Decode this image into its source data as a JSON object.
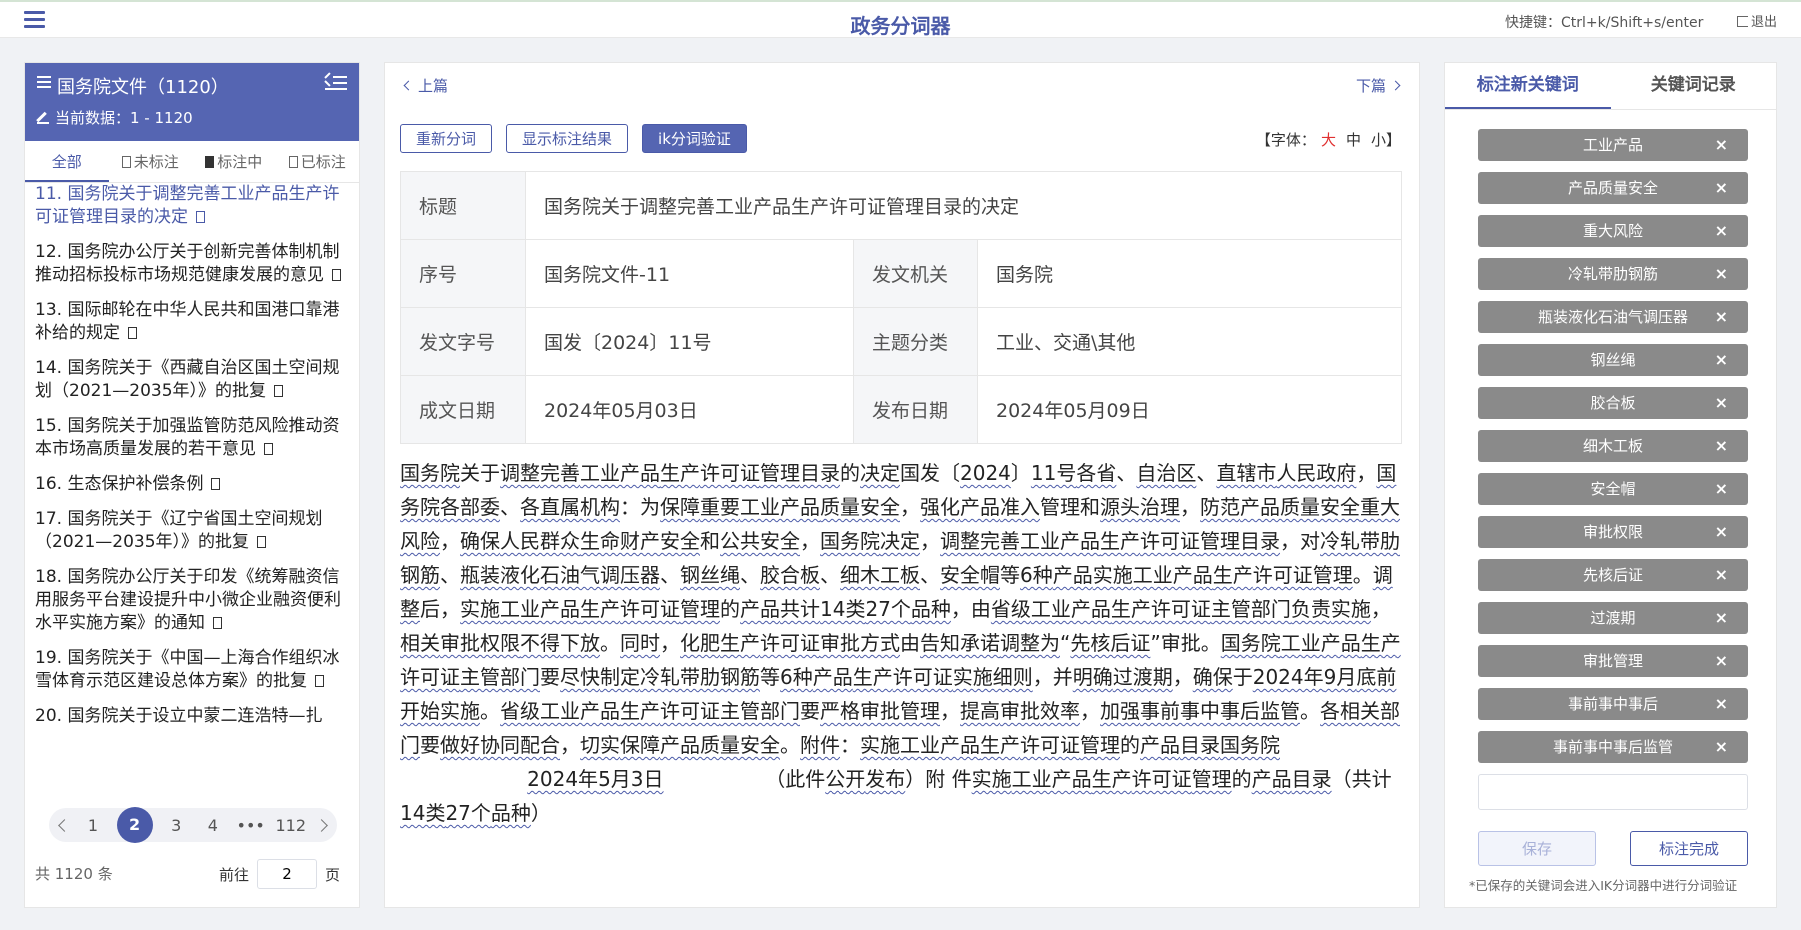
{
  "app": {
    "title": "政务分词器",
    "shortcut": "快捷键：Ctrl+k/Shift+s/enter",
    "logout": "退出"
  },
  "sidebar": {
    "title": "国务院文件（1120）",
    "current_data": "当前数据：1 - 1120",
    "tabs": [
      "全部",
      "未标注",
      "标注中",
      "已标注"
    ],
    "items": [
      "11. 国务院关于调整完善工业产品生产许可证管理目录的决定",
      "12. 国务院办公厅关于创新完善体制机制推动招标投标市场规范健康发展的意见",
      "13. 国际邮轮在中华人民共和国港口靠港补给的规定",
      "14. 国务院关于《西藏自治区国土空间规划（2021—2035年）》的批复",
      "15. 国务院关于加强监管防范风险推动资本市场高质量发展的若干意见",
      "16. 生态保护补偿条例",
      "17. 国务院关于《辽宁省国土空间规划（2021—2035年）》的批复",
      "18. 国务院办公厅关于印发《统筹融资信用服务平台建设提升中小微企业融资便利水平实施方案》的通知",
      "19. 国务院关于《中国—上海合作组织冰雪体育示范区建设总体方案》的批复",
      "20. 国务院关于设立中蒙二连浩特—扎"
    ],
    "pager": {
      "pages": [
        "1",
        "2",
        "3",
        "4",
        "•••",
        "112"
      ],
      "current": "2",
      "total": "共 1120 条",
      "goto_label": "前往",
      "goto_value": "2",
      "goto_suffix": "页"
    }
  },
  "main": {
    "prev": "上篇",
    "next": "下篇",
    "buttons": {
      "resegment": "重新分词",
      "show_result": "显示标注结果",
      "ik_verify": "ik分词验证"
    },
    "font": {
      "label": "【字体：",
      "large": "大",
      "medium": "中",
      "small": "小",
      "close": "】"
    },
    "meta": {
      "title_label": "标题",
      "title_value": "国务院关于调整完善工业产品生产许可证管理目录的决定",
      "serial_label": "序号",
      "serial_value": "国务院文件-11",
      "issuer_label": "发文机关",
      "issuer_value": "国务院",
      "docno_label": "发文字号",
      "docno_value": "国发〔2024〕11号",
      "topic_label": "主题分类",
      "topic_value": "工业、交通\\其他",
      "written_label": "成文日期",
      "written_value": "2024年05月03日",
      "publish_label": "发布日期",
      "publish_value": "2024年05月09日"
    },
    "body_segments": [
      {
        "t": "国务院",
        "k": 1
      },
      {
        "t": "关于",
        "k": 0
      },
      {
        "t": "调整",
        "k": 1
      },
      {
        "t": "完善",
        "k": 1
      },
      {
        "t": "工业产品",
        "k": 1
      },
      {
        "t": "生产",
        "k": 1
      },
      {
        "t": "许可证",
        "k": 1
      },
      {
        "t": "管理",
        "k": 1
      },
      {
        "t": "目录",
        "k": 1
      },
      {
        "t": "的",
        "k": 0
      },
      {
        "t": "决定",
        "k": 1
      },
      {
        "t": "国发〔",
        "k": 0
      },
      {
        "t": "2024",
        "k": 1
      },
      {
        "t": "〕",
        "k": 0
      },
      {
        "t": "11号",
        "k": 1
      },
      {
        "t": "各省",
        "k": 1
      },
      {
        "t": "、",
        "k": 0
      },
      {
        "t": "自治区",
        "k": 1
      },
      {
        "t": "、",
        "k": 0
      },
      {
        "t": "直辖市",
        "k": 1
      },
      {
        "t": "人民政府",
        "k": 1
      },
      {
        "t": "，",
        "k": 0
      },
      {
        "t": "国务院",
        "k": 1
      },
      {
        "t": "各部委",
        "k": 1
      },
      {
        "t": "、",
        "k": 0
      },
      {
        "t": "各直属机构",
        "k": 1
      },
      {
        "t": "：为",
        "k": 0
      },
      {
        "t": "保障",
        "k": 1
      },
      {
        "t": "重要",
        "k": 1
      },
      {
        "t": "工业产品",
        "k": 1
      },
      {
        "t": "质量安全",
        "k": 1
      },
      {
        "t": "，",
        "k": 0
      },
      {
        "t": "强化",
        "k": 1
      },
      {
        "t": "产品",
        "k": 1
      },
      {
        "t": "准入",
        "k": 1
      },
      {
        "t": "管理",
        "k": 0
      },
      {
        "t": "和",
        "k": 0
      },
      {
        "t": "源头治理",
        "k": 1
      },
      {
        "t": "，",
        "k": 0
      },
      {
        "t": "防范",
        "k": 1
      },
      {
        "t": "产品质量安全",
        "k": 1
      },
      {
        "t": "重大风险",
        "k": 1
      },
      {
        "t": "，",
        "k": 0
      },
      {
        "t": "确保",
        "k": 1
      },
      {
        "t": "人民群众",
        "k": 1
      },
      {
        "t": "生命财产安全",
        "k": 1
      },
      {
        "t": "和",
        "k": 0
      },
      {
        "t": "公共安全",
        "k": 1
      },
      {
        "t": "，",
        "k": 0
      },
      {
        "t": "国务院",
        "k": 1
      },
      {
        "t": "决定",
        "k": 1
      },
      {
        "t": "，",
        "k": 0
      },
      {
        "t": "调整",
        "k": 1
      },
      {
        "t": "完善",
        "k": 1
      },
      {
        "t": "工业产品",
        "k": 1
      },
      {
        "t": "生产",
        "k": 1
      },
      {
        "t": "许可证",
        "k": 1
      },
      {
        "t": "管理",
        "k": 1
      },
      {
        "t": "目录",
        "k": 1
      },
      {
        "t": "，对",
        "k": 0
      },
      {
        "t": "冷轧带肋钢筋",
        "k": 1
      },
      {
        "t": "、",
        "k": 0
      },
      {
        "t": "瓶装液化石油气调压器",
        "k": 1
      },
      {
        "t": "、",
        "k": 0
      },
      {
        "t": "钢丝绳",
        "k": 1
      },
      {
        "t": "、",
        "k": 0
      },
      {
        "t": "胶合板",
        "k": 1
      },
      {
        "t": "、",
        "k": 0
      },
      {
        "t": "细木工板",
        "k": 1
      },
      {
        "t": "、",
        "k": 0
      },
      {
        "t": "安全帽",
        "k": 1
      },
      {
        "t": "等",
        "k": 0
      },
      {
        "t": "6种",
        "k": 1
      },
      {
        "t": "产品",
        "k": 1
      },
      {
        "t": "实施",
        "k": 1
      },
      {
        "t": "工业产品",
        "k": 1
      },
      {
        "t": "生产",
        "k": 1
      },
      {
        "t": "许可证",
        "k": 1
      },
      {
        "t": "管理",
        "k": 1
      },
      {
        "t": "。",
        "k": 0
      },
      {
        "t": "调整",
        "k": 1
      },
      {
        "t": "后，",
        "k": 0
      },
      {
        "t": "实施",
        "k": 1
      },
      {
        "t": "工业产品",
        "k": 1
      },
      {
        "t": "生产",
        "k": 1
      },
      {
        "t": "许可证",
        "k": 1
      },
      {
        "t": "管理",
        "k": 1
      },
      {
        "t": "的",
        "k": 0
      },
      {
        "t": "产品",
        "k": 1
      },
      {
        "t": "共计",
        "k": 1
      },
      {
        "t": "14类",
        "k": 1
      },
      {
        "t": "27个",
        "k": 1
      },
      {
        "t": "品种",
        "k": 1
      },
      {
        "t": "，由",
        "k": 0
      },
      {
        "t": "省级",
        "k": 1
      },
      {
        "t": "工业产品",
        "k": 1
      },
      {
        "t": "生产",
        "k": 1
      },
      {
        "t": "许可证",
        "k": 1
      },
      {
        "t": "主管部门",
        "k": 1
      },
      {
        "t": "负责",
        "k": 1
      },
      {
        "t": "实施",
        "k": 1
      },
      {
        "t": "，",
        "k": 0
      },
      {
        "t": "相关",
        "k": 1
      },
      {
        "t": "审批权限",
        "k": 1
      },
      {
        "t": "不得",
        "k": 1
      },
      {
        "t": "下放",
        "k": 1
      },
      {
        "t": "。",
        "k": 0
      },
      {
        "t": "同时",
        "k": 1
      },
      {
        "t": "，",
        "k": 0
      },
      {
        "t": "化肥",
        "k": 1
      },
      {
        "t": "生产",
        "k": 1
      },
      {
        "t": "许可证",
        "k": 1
      },
      {
        "t": "审批",
        "k": 1
      },
      {
        "t": "方式",
        "k": 1
      },
      {
        "t": "由",
        "k": 0
      },
      {
        "t": "告知承诺",
        "k": 1
      },
      {
        "t": "调整为",
        "k": 1
      },
      {
        "t": "“",
        "k": 0
      },
      {
        "t": "先核后证",
        "k": 1
      },
      {
        "t": "”审批。",
        "k": 0
      },
      {
        "t": "国务院",
        "k": 1
      },
      {
        "t": "工业产品",
        "k": 1
      },
      {
        "t": "生产",
        "k": 1
      },
      {
        "t": "许可证",
        "k": 1
      },
      {
        "t": "主管部门",
        "k": 1
      },
      {
        "t": "要",
        "k": 0
      },
      {
        "t": "尽快",
        "k": 1
      },
      {
        "t": "制定",
        "k": 1
      },
      {
        "t": "冷轧带肋钢筋",
        "k": 1
      },
      {
        "t": "等",
        "k": 0
      },
      {
        "t": "6种",
        "k": 1
      },
      {
        "t": "产品",
        "k": 1
      },
      {
        "t": "生产",
        "k": 1
      },
      {
        "t": "许可证",
        "k": 1
      },
      {
        "t": "实施细则",
        "k": 1
      },
      {
        "t": "，并",
        "k": 0
      },
      {
        "t": "明确",
        "k": 1
      },
      {
        "t": "过渡期",
        "k": 1
      },
      {
        "t": "，",
        "k": 0
      },
      {
        "t": "确保",
        "k": 1
      },
      {
        "t": "于",
        "k": 0
      },
      {
        "t": "2024年",
        "k": 1
      },
      {
        "t": "9月",
        "k": 1
      },
      {
        "t": "底前",
        "k": 1
      },
      {
        "t": "开始",
        "k": 1
      },
      {
        "t": "实施",
        "k": 1
      },
      {
        "t": "。",
        "k": 0
      },
      {
        "t": "省级",
        "k": 1
      },
      {
        "t": "工业产品",
        "k": 1
      },
      {
        "t": "生产",
        "k": 1
      },
      {
        "t": "许可证",
        "k": 1
      },
      {
        "t": "主管部门",
        "k": 1
      },
      {
        "t": "要",
        "k": 0
      },
      {
        "t": "严格",
        "k": 1
      },
      {
        "t": "审批管理",
        "k": 1
      },
      {
        "t": "，",
        "k": 0
      },
      {
        "t": "提高",
        "k": 1
      },
      {
        "t": "审批",
        "k": 1
      },
      {
        "t": "效率",
        "k": 1
      },
      {
        "t": "，",
        "k": 0
      },
      {
        "t": "加强",
        "k": 1
      },
      {
        "t": "事前事中事后监管",
        "k": 1
      },
      {
        "t": "。",
        "k": 0
      },
      {
        "t": "各相关部门",
        "k": 1
      },
      {
        "t": "要",
        "k": 0
      },
      {
        "t": "做好",
        "k": 1
      },
      {
        "t": "协同配合",
        "k": 1
      },
      {
        "t": "，",
        "k": 0
      },
      {
        "t": "切实",
        "k": 1
      },
      {
        "t": "保障",
        "k": 1
      },
      {
        "t": "产品质量安全",
        "k": 1
      },
      {
        "t": "。",
        "k": 0
      },
      {
        "t": "附件",
        "k": 1
      },
      {
        "t": "：",
        "k": 0
      },
      {
        "t": "实施",
        "k": 1
      },
      {
        "t": "工业产品",
        "k": 1
      },
      {
        "t": "生产",
        "k": 1
      },
      {
        "t": "许可证",
        "k": 1
      },
      {
        "t": "管理",
        "k": 1
      },
      {
        "t": "的",
        "k": 0
      },
      {
        "t": "产品",
        "k": 1
      },
      {
        "t": "目录",
        "k": 1
      },
      {
        "t": "国务院",
        "k": 1
      },
      {
        "t": "                    ",
        "k": 0
      },
      {
        "t": "2024年",
        "k": 1
      },
      {
        "t": "5月",
        "k": 1
      },
      {
        "t": "3日",
        "k": 1
      },
      {
        "t": "                ",
        "k": 0
      },
      {
        "t": "（此件",
        "k": 0
      },
      {
        "t": "公开",
        "k": 1
      },
      {
        "t": "发布",
        "k": 1
      },
      {
        "t": "）附    件",
        "k": 0
      },
      {
        "t": "实施",
        "k": 1
      },
      {
        "t": "工业产品",
        "k": 1
      },
      {
        "t": "生产",
        "k": 1
      },
      {
        "t": "许可证",
        "k": 1
      },
      {
        "t": "管理",
        "k": 1
      },
      {
        "t": "的",
        "k": 0
      },
      {
        "t": "产品",
        "k": 1
      },
      {
        "t": "目录",
        "k": 1
      },
      {
        "t": "（共计",
        "k": 0
      },
      {
        "t": "14类",
        "k": 1
      },
      {
        "t": "27个",
        "k": 1
      },
      {
        "t": "品种",
        "k": 1
      },
      {
        "t": "）",
        "k": 0
      }
    ]
  },
  "keywords_panel": {
    "tabs": [
      "标注新关键词",
      "关键词记录"
    ],
    "keywords": [
      "工业产品",
      "产品质量安全",
      "重大风险",
      "冷轧带肋钢筋",
      "瓶装液化石油气调压器",
      "钢丝绳",
      "胶合板",
      "细木工板",
      "安全帽",
      "审批权限",
      "先核后证",
      "过渡期",
      "审批管理",
      "事前事中事后",
      "事前事中事后监管"
    ],
    "remove_symbol": "×",
    "input_value": "",
    "save": "保存",
    "done": "标注完成",
    "note": "*已保存的关键词会进入IK分词器中进行分词验证"
  },
  "colors": {
    "accent": "#4a5aa8",
    "header": "#5565b2",
    "tag": "#8a8a8a",
    "font_large": "#e03030"
  }
}
